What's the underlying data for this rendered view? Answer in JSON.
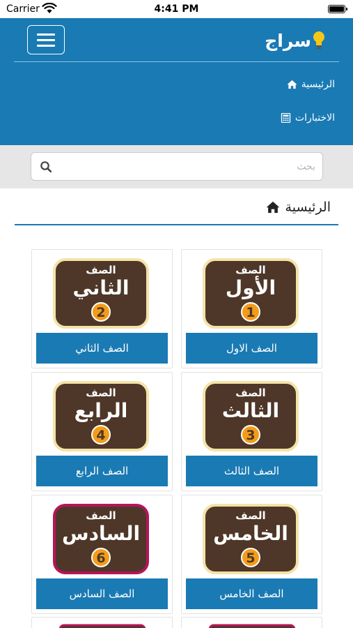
{
  "status_bar": {
    "carrier": "Carrier",
    "time": "4:41 PM"
  },
  "header": {
    "logo_text": "سراج",
    "nav": [
      {
        "label": "الرئيسية",
        "icon": "home-icon"
      },
      {
        "label": "الاختبارات",
        "icon": "calculator-icon"
      }
    ]
  },
  "search": {
    "placeholder": "بحث",
    "icon": "search-icon"
  },
  "page": {
    "title": "الرئيسية",
    "icon": "home-icon"
  },
  "colors": {
    "primary": "#1a7ab4",
    "badge": "#f39c1a",
    "board": "#4e3728",
    "board_frame": "#f3e3a8",
    "board_frame_alt": "#b4155a"
  },
  "grades": [
    {
      "label": "الصف الاول",
      "art_top": "الصف",
      "art_main": "الأول",
      "number": "1"
    },
    {
      "label": "الصف الثاني",
      "art_top": "الصف",
      "art_main": "الثاني",
      "number": "2"
    },
    {
      "label": "الصف الثالث",
      "art_top": "الصف",
      "art_main": "الثالث",
      "number": "3"
    },
    {
      "label": "الصف الرابع",
      "art_top": "الصف",
      "art_main": "الرابع",
      "number": "4"
    },
    {
      "label": "الصف الخامس",
      "art_top": "الصف",
      "art_main": "الخامس",
      "number": "5"
    },
    {
      "label": "الصف السادس",
      "art_top": "الصف",
      "art_main": "السادس",
      "number": "6"
    }
  ]
}
